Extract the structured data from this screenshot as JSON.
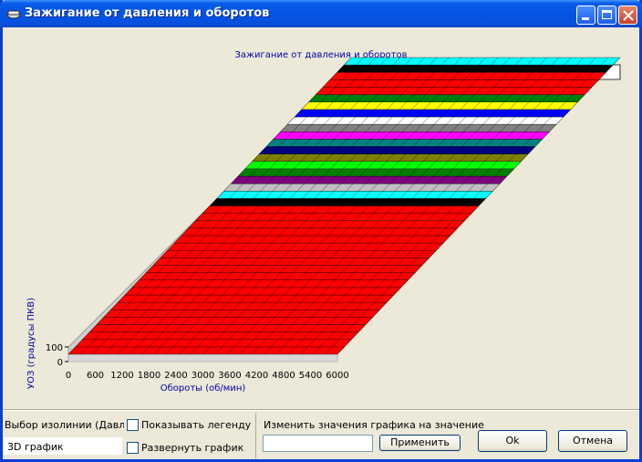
{
  "window": {
    "title": "Зажигание от давления и оборотов"
  },
  "chart": {
    "title": "Зажигание от давления и оборотов",
    "xlabel": "Обороты (об/мин)",
    "ylabel": "УОЗ (градусы ПКВ)",
    "x_ticks": [
      "0",
      "600",
      "1200",
      "1800",
      "2400",
      "3000",
      "3600",
      "4200",
      "4800",
      "5400",
      "6000"
    ],
    "y_ticks": [
      "100",
      "0"
    ],
    "band_colors": [
      "#ff0000",
      "#ff0000",
      "#008000",
      "#ffff00",
      "#0000ff",
      "#ffffff",
      "#808080",
      "#ff00ff",
      "#008080",
      "#000080",
      "#808000",
      "#00ff00",
      "#008000",
      "#800080",
      "#c0c0c0",
      "#00ffff",
      "#000000",
      "#ff0000"
    ]
  },
  "chart_data": {
    "type": "surface",
    "title": "Зажигание от давления и оборотов",
    "xlabel": "Обороты (об/мин)",
    "ylabel": "УОЗ (градусы ПКВ)",
    "x": [
      0,
      600,
      1200,
      1800,
      2400,
      3000,
      3600,
      4200,
      4800,
      5400,
      6000
    ],
    "ylim": [
      0,
      100
    ]
  },
  "controls": {
    "isoline_label": "Выбор изолинии (Давление",
    "show_legend_label": "Показывать легенду",
    "expand_graph_label": "Развернуть график",
    "mode_value": "3D график",
    "change_values_label": "Изменить значения графика на значение",
    "value_input": "",
    "apply_label": "Применить",
    "ok_label": "Ok",
    "cancel_label": "Отмена"
  }
}
